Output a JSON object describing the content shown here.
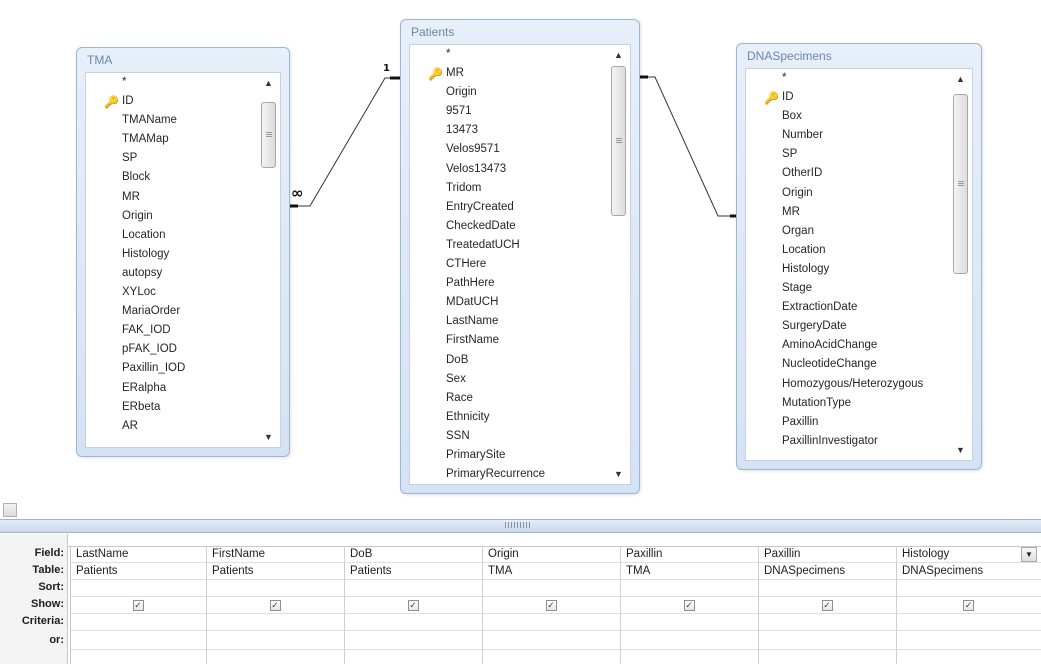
{
  "tables": {
    "tma": {
      "title": "TMA",
      "fields": [
        "*",
        "ID",
        "TMAName",
        "TMAMap",
        "SP",
        "Block",
        "MR",
        "Origin",
        "Location",
        "Histology",
        "autopsy",
        "XYLoc",
        "MariaOrder",
        "FAK_IOD",
        "pFAK_IOD",
        "Paxillin_IOD",
        "ERalpha",
        "ERbeta",
        "AR"
      ],
      "key_field": "ID"
    },
    "patients": {
      "title": "Patients",
      "fields": [
        "*",
        "MR",
        "Origin",
        "9571",
        "13473",
        "Velos9571",
        "Velos13473",
        "Tridom",
        "EntryCreated",
        "CheckedDate",
        "TreatedatUCH",
        "CTHere",
        "PathHere",
        "MDatUCH",
        "LastName",
        "FirstName",
        "DoB",
        "Sex",
        "Race",
        "Ethnicity",
        "SSN",
        "PrimarySite",
        "PrimaryRecurrence"
      ],
      "key_field": "MR"
    },
    "dnaspecimens": {
      "title": "DNASpecimens",
      "fields": [
        "*",
        "ID",
        "Box",
        "Number",
        "SP",
        "OtherID",
        "Origin",
        "MR",
        "Organ",
        "Location",
        "Histology",
        "Stage",
        "ExtractionDate",
        "SurgeryDate",
        "AminoAcidChange",
        "NucleotideChange",
        "Homozygous/Heterozygous",
        "MutationType",
        "Paxillin",
        "PaxillinInvestigator"
      ],
      "key_field": "ID"
    }
  },
  "relationships": {
    "one_symbol": "1",
    "many_symbol": "∞"
  },
  "icons": {
    "key": "key-icon",
    "scroll_up": "arrow-up-icon",
    "scroll_down": "arrow-down-icon",
    "dropdown": "chevron-down-icon"
  },
  "glyphs": {
    "key": "🔑",
    "up": "▲",
    "down": "▼",
    "check": "✓"
  },
  "grid": {
    "row_labels": [
      "Field:",
      "Table:",
      "Sort:",
      "Show:",
      "Criteria:",
      "or:"
    ],
    "columns": [
      {
        "field": "LastName",
        "table": "Patients",
        "show": true
      },
      {
        "field": "FirstName",
        "table": "Patients",
        "show": true
      },
      {
        "field": "DoB",
        "table": "Patients",
        "show": true
      },
      {
        "field": "Origin",
        "table": "TMA",
        "show": true
      },
      {
        "field": "Paxillin",
        "table": "TMA",
        "show": true
      },
      {
        "field": "Paxillin",
        "table": "DNASpecimens",
        "show": true
      },
      {
        "field": "Histology",
        "table": "DNASpecimens",
        "show": true
      }
    ]
  },
  "colors": {
    "table_title": "#6d86a8",
    "table_border": "#9cb6d4",
    "splitter": "#c9d8eb"
  }
}
